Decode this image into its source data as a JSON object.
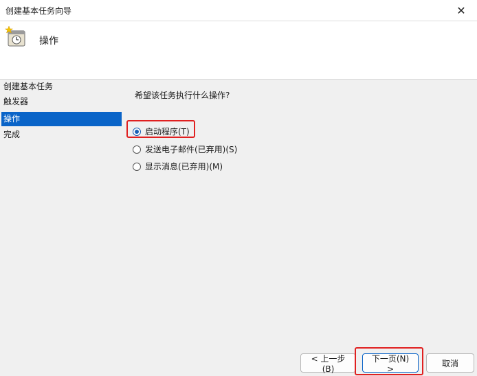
{
  "window": {
    "title": "创建基本任务向导",
    "close_glyph": "✕"
  },
  "header": {
    "icon": "task-scheduler-icon",
    "title": "操作"
  },
  "sidebar": {
    "items": [
      {
        "label": "创建基本任务",
        "active": false
      },
      {
        "label": "触发器",
        "active": false
      },
      {
        "label": "操作",
        "active": true
      },
      {
        "label": "完成",
        "active": false
      }
    ]
  },
  "main": {
    "question": "希望该任务执行什么操作?",
    "options": [
      {
        "label": "启动程序(T)",
        "checked": true
      },
      {
        "label": "发送电子邮件(已弃用)(S)",
        "checked": false
      },
      {
        "label": "显示消息(已弃用)(M)",
        "checked": false
      }
    ]
  },
  "buttons": {
    "back": "< 上一步(B)",
    "next": "下一页(N) >",
    "cancel": "取消"
  },
  "colors": {
    "accent": "#0a64c8",
    "highlight": "#e02020"
  }
}
